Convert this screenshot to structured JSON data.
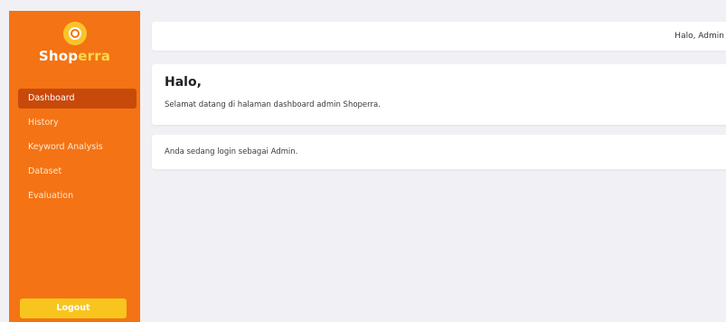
{
  "sidebar": {
    "brand_prefix": "Shop",
    "brand_suffix": "erra",
    "items": [
      {
        "label": "Dashboard",
        "active": true
      },
      {
        "label": "History",
        "active": false
      },
      {
        "label": "Keyword Analysis",
        "active": false
      },
      {
        "label": "Dataset",
        "active": false
      },
      {
        "label": "Evaluation",
        "active": false
      }
    ],
    "logout_label": "Logout"
  },
  "header": {
    "greeting": "Halo, Admin"
  },
  "main": {
    "welcome_title": "Halo,",
    "welcome_text": "Selamat datang di halaman dashboard admin Shoperra.",
    "role_text": "Anda sedang login sebagai Admin."
  },
  "colors": {
    "sidebar": "#f47314",
    "active_item": "#c84a0b",
    "logout": "#f8c51f",
    "page_background": "#f1f0f4"
  },
  "icons": {
    "logo": "shoperra-logo-icon"
  }
}
